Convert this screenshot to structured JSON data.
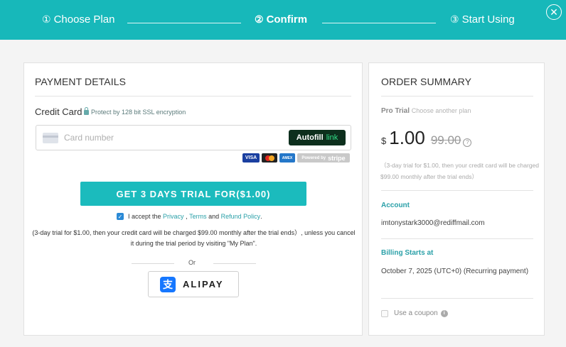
{
  "steps": [
    {
      "num": "①",
      "label": "Choose Plan"
    },
    {
      "num": "②",
      "label": "Confirm"
    },
    {
      "num": "③",
      "label": "Start Using"
    }
  ],
  "close_glyph": "✕",
  "payment": {
    "title": "PAYMENT DETAILS",
    "credit_card_label": "Credit Card",
    "ssl_text": "Protect by 128 bit SSL encryption",
    "card_placeholder": "Card number",
    "autofill_label": "Autofill",
    "autofill_link": "link",
    "logos": {
      "visa": "VISA",
      "amex": "AMEX",
      "stripe_prefix": "Powered by",
      "stripe": "stripe"
    },
    "cta_label": "GET 3 DAYS TRIAL FOR($1.00)",
    "accept": {
      "checked": true,
      "prefix": "I accept the",
      "privacy": "Privacy",
      "sep1": " , ",
      "terms": "Terms",
      "and": " and ",
      "refund": "Refund Policy",
      "end": "."
    },
    "note": "(3-day trial for $1.00, then your credit card will be charged $99.00 monthly after the trial ends）, unless you cancel it during the trial period by visiting \"My Plan\".",
    "or_text": "Or",
    "alipay_label": "ALIPAY",
    "alipay_glyph": "支"
  },
  "summary": {
    "title": "ORDER SUMMARY",
    "plan_name": "Pro Trial",
    "choose_another": "Choose another plan",
    "currency": "$",
    "price": "1.00",
    "original_price": "99.00",
    "help_glyph": "?",
    "trial_note": "（3-day trial for $1.00, then your credit card will be charged $99.00 monthly after the trial ends）",
    "account_label": "Account",
    "account_value": "imtonystark3000@rediffmail.com",
    "billing_label": "Billing Starts at",
    "billing_value": "October 7, 2025 (UTC+0) (Recurring payment)",
    "coupon_label": "Use a coupon",
    "info_glyph": "i"
  },
  "colors": {
    "accent": "#17b8ba",
    "link": "#2aa0a8",
    "alipay": "#1677ff",
    "autofill_bg": "#0d2f1d",
    "autofill_link": "#33e08a"
  }
}
